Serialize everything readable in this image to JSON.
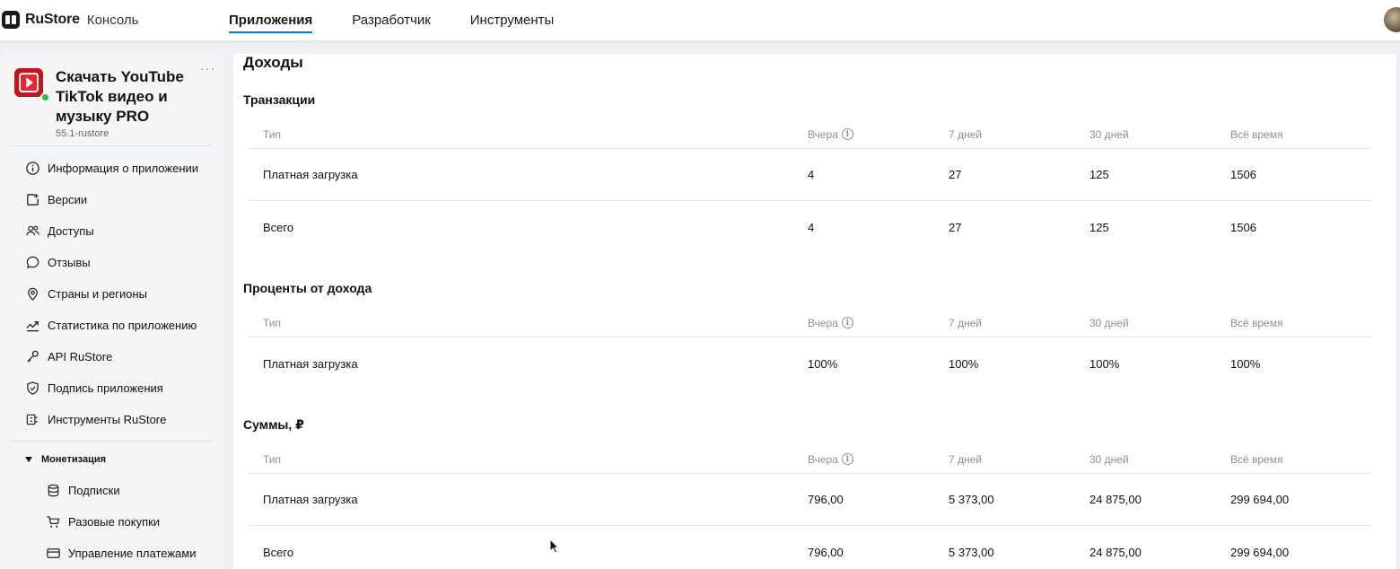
{
  "topbar": {
    "logo_name": "RuStore",
    "logo_sub": "Консоль",
    "nav": [
      {
        "label": "Приложения",
        "active": true
      },
      {
        "label": "Разработчик",
        "active": false
      },
      {
        "label": "Инструменты",
        "active": false
      }
    ]
  },
  "sidebar": {
    "app_title": "Скачать YouTube TikTok видео и музыку PRO",
    "app_version": "55.1-rustore",
    "more": "···",
    "items": [
      {
        "label": "Информация о приложении",
        "icon": "info-icon"
      },
      {
        "label": "Версии",
        "icon": "versions-icon"
      },
      {
        "label": "Доступы",
        "icon": "users-icon"
      },
      {
        "label": "Отзывы",
        "icon": "chat-icon"
      },
      {
        "label": "Страны и регионы",
        "icon": "location-pin-icon"
      },
      {
        "label": "Статистика по приложению",
        "icon": "chart-icon"
      },
      {
        "label": "API RuStore",
        "icon": "key-icon"
      },
      {
        "label": "Подпись приложения",
        "icon": "shield-check-icon"
      },
      {
        "label": "Инструменты RuStore",
        "icon": "tools-icon"
      }
    ],
    "monetization": {
      "label": "Монетизация",
      "items": [
        {
          "label": "Подписки",
          "icon": "database-icon"
        },
        {
          "label": "Разовые покупки",
          "icon": "cart-icon"
        },
        {
          "label": "Управление платежами",
          "icon": "card-icon"
        }
      ]
    }
  },
  "main": {
    "title": "Доходы",
    "columns": {
      "type": "Тип",
      "yesterday": "Вчера",
      "days7": "7 дней",
      "days30": "30 дней",
      "all": "Всё время"
    },
    "sections": [
      {
        "title": "Транзакции",
        "rows": [
          {
            "type": "Платная загрузка",
            "yesterday": "4",
            "days7": "27",
            "days30": "125",
            "all": "1506"
          },
          {
            "type": "Всего",
            "yesterday": "4",
            "days7": "27",
            "days30": "125",
            "all": "1506"
          }
        ]
      },
      {
        "title": "Проценты от дохода",
        "rows": [
          {
            "type": "Платная загрузка",
            "yesterday": "100%",
            "days7": "100%",
            "days30": "100%",
            "all": "100%"
          }
        ]
      },
      {
        "title": "Суммы, ₽",
        "rows": [
          {
            "type": "Платная загрузка",
            "yesterday": "796,00",
            "days7": "5 373,00",
            "days30": "24 875,00",
            "all": "299 694,00"
          },
          {
            "type": "Всего",
            "yesterday": "796,00",
            "days7": "5 373,00",
            "days30": "24 875,00",
            "all": "299 694,00"
          }
        ]
      }
    ]
  },
  "colors": {
    "accent": "#0077ff",
    "status_online": "#2db84d",
    "app_icon": "#c3141c"
  }
}
